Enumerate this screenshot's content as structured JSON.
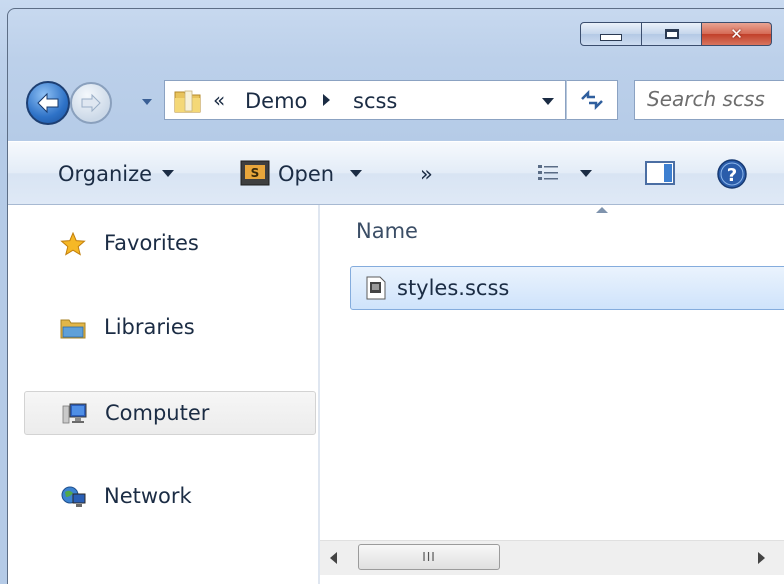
{
  "window": {
    "caption_buttons": {
      "close_glyph": "✕"
    }
  },
  "navigation": {
    "address": {
      "chevron": "«",
      "segments": [
        "Demo",
        "scss"
      ]
    },
    "search": {
      "placeholder": "Search scss"
    }
  },
  "toolbar": {
    "organize_label": "Organize",
    "open_label": "Open",
    "more_label": "»"
  },
  "nav_pane": {
    "items": [
      {
        "label": "Favorites",
        "icon": "star-icon",
        "selected": false
      },
      {
        "label": "Libraries",
        "icon": "libraries-icon",
        "selected": false
      },
      {
        "label": "Computer",
        "icon": "computer-icon",
        "selected": true
      },
      {
        "label": "Network",
        "icon": "network-icon",
        "selected": false
      }
    ]
  },
  "content": {
    "column_header": "Name",
    "files": [
      {
        "name": "styles.scss",
        "selected": true
      }
    ],
    "scroll_grip": "III"
  },
  "colors": {
    "frame": "#bcd0ea",
    "selection": "#cfe3fb",
    "close_button": "#c1402a",
    "text": "#1b2c44"
  }
}
